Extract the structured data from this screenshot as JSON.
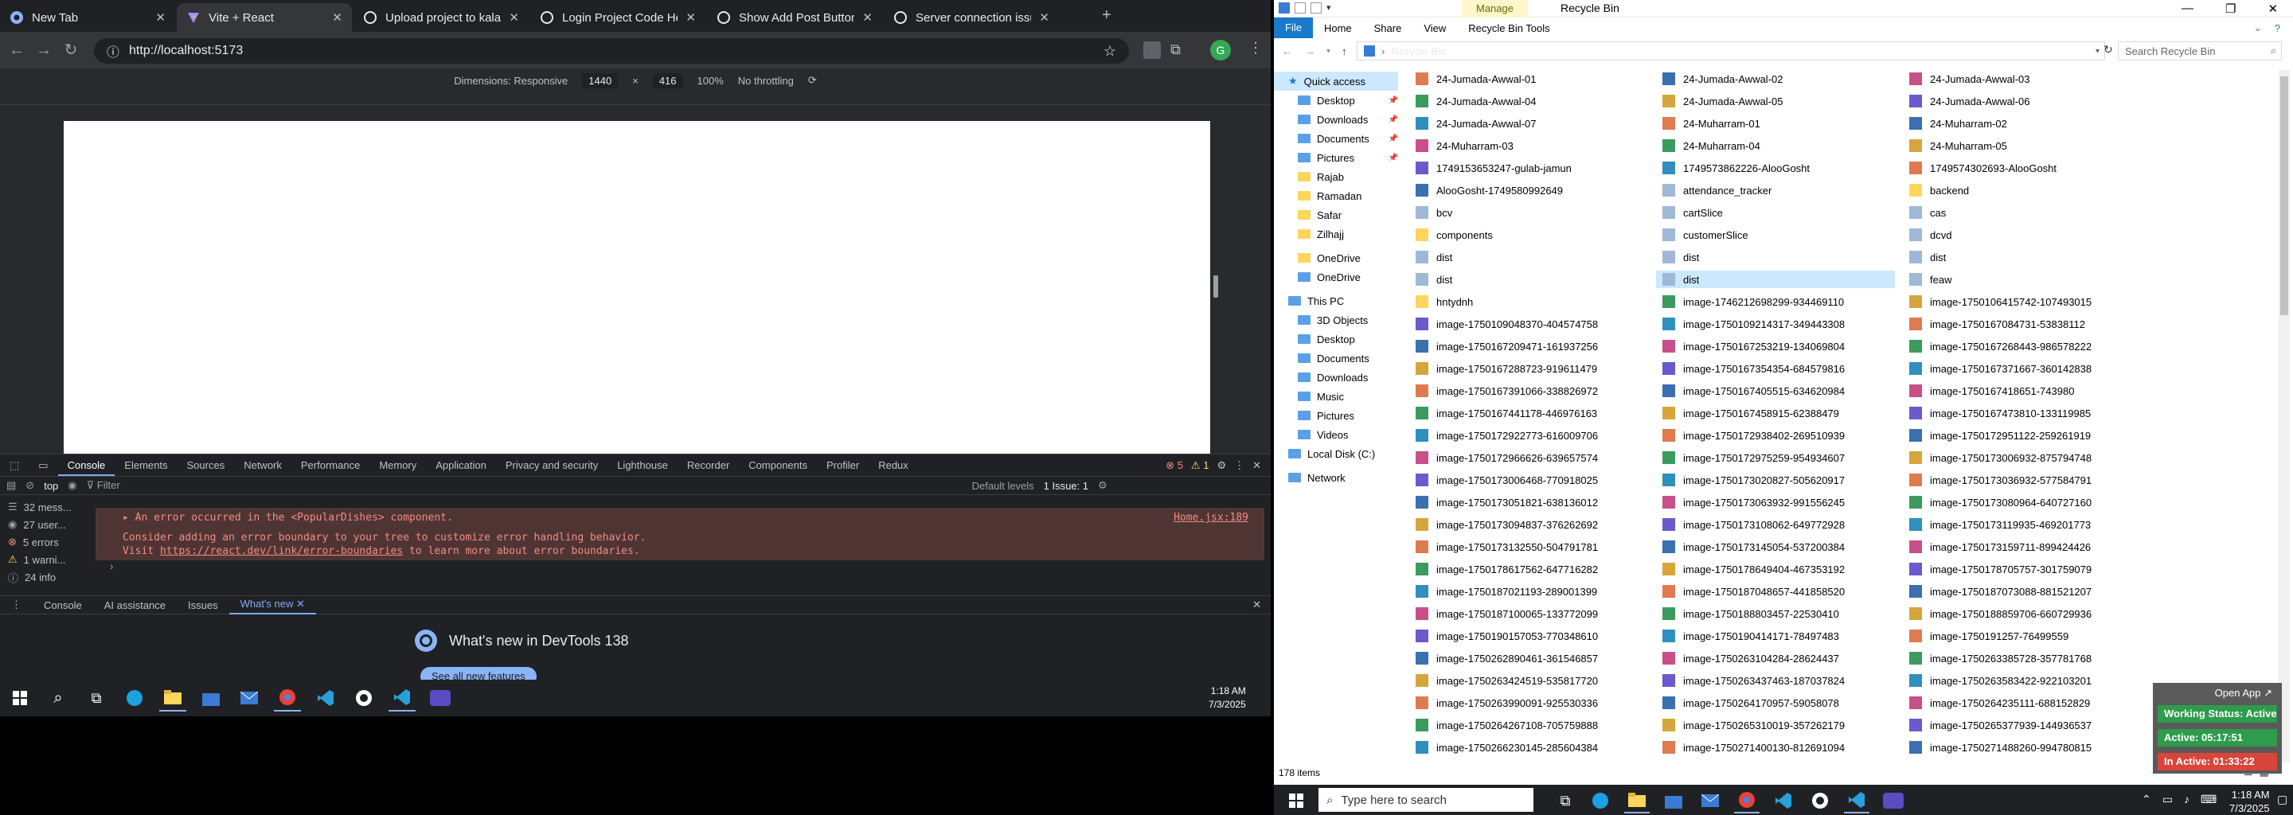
{
  "chrome": {
    "tabs": [
      {
        "title": "New Tab"
      },
      {
        "title": "Vite + React"
      },
      {
        "title": "Upload project to kalams.org"
      },
      {
        "title": "Login Project Code Help"
      },
      {
        "title": "Show Add Post Button"
      },
      {
        "title": "Server connection issue fix"
      }
    ],
    "url": "http://localhost:5173",
    "device_toolbar": {
      "dimensions_label": "Dimensions: Responsive",
      "width": "1440",
      "height": "416",
      "zoom": "100%",
      "throttle": "No throttling"
    },
    "devtools": {
      "tabs": [
        "Console",
        "Elements",
        "Sources",
        "Network",
        "Performance",
        "Memory",
        "Application",
        "Privacy and security",
        "Lighthouse",
        "Recorder",
        "Components",
        "Profiler",
        "Redux"
      ],
      "errors_badge": "5",
      "warn_badge": "1",
      "filter_context": "top",
      "filter_placeholder": "Filter",
      "levels": "Default levels",
      "issues": "1 Issue: 1",
      "sidebar": [
        "32 mess...",
        "27 user...",
        "5 errors",
        "1 warni...",
        "24 info"
      ],
      "error_line1": "An error occurred in the <PopularDishes> component.",
      "error_source": "Home.jsx:189",
      "error_line2": "Consider adding an error boundary to your tree to customize error handling behavior.",
      "error_line3_pre": "Visit ",
      "error_link": "https://react.dev/link/error-boundaries",
      "error_line3_post": " to learn more about error boundaries.",
      "drawer_tabs": [
        "Console",
        "AI assistance",
        "Issues",
        "What's new"
      ],
      "whats_new": "What's new in DevTools 138",
      "see_all": "See all new features"
    },
    "clock": {
      "time": "1:18 AM",
      "date": "7/3/2025"
    }
  },
  "explorer": {
    "manage": "Manage",
    "title": "Recycle Bin",
    "ribbon": [
      "File",
      "Home",
      "Share",
      "View",
      "Recycle Bin Tools"
    ],
    "address": "Recycle Bin",
    "search_placeholder": "Search Recycle Bin",
    "nav": [
      {
        "label": "Quick access",
        "type": "star"
      },
      {
        "label": "Desktop",
        "type": "blue",
        "pin": true
      },
      {
        "label": "Downloads",
        "type": "blue",
        "pin": true
      },
      {
        "label": "Documents",
        "type": "blue",
        "pin": true
      },
      {
        "label": "Pictures",
        "type": "blue",
        "pin": true
      },
      {
        "label": "Rajab",
        "type": "folder"
      },
      {
        "label": "Ramadan",
        "type": "folder"
      },
      {
        "label": "Safar",
        "type": "folder"
      },
      {
        "label": "Zilhajj",
        "type": "folder"
      },
      {
        "label": "OneDrive",
        "type": "folder"
      },
      {
        "label": "OneDrive",
        "type": "blue"
      },
      {
        "label": "This PC",
        "type": "pc"
      },
      {
        "label": "3D Objects",
        "type": "blue"
      },
      {
        "label": "Desktop",
        "type": "blue"
      },
      {
        "label": "Documents",
        "type": "blue"
      },
      {
        "label": "Downloads",
        "type": "blue"
      },
      {
        "label": "Music",
        "type": "blue"
      },
      {
        "label": "Pictures",
        "type": "blue"
      },
      {
        "label": "Videos",
        "type": "blue"
      },
      {
        "label": "Local Disk (C:)",
        "type": "pc"
      },
      {
        "label": "Network",
        "type": "pc"
      }
    ],
    "files": [
      [
        "24-Jumada-Awwal-01",
        "24-Jumada-Awwal-02",
        "24-Jumada-Awwal-03"
      ],
      [
        "24-Jumada-Awwal-04",
        "24-Jumada-Awwal-05",
        "24-Jumada-Awwal-06"
      ],
      [
        "24-Jumada-Awwal-07",
        "24-Muharram-01",
        "24-Muharram-02"
      ],
      [
        "24-Muharram-03",
        "24-Muharram-04",
        "24-Muharram-05"
      ],
      [
        "1749153653247-gulab-jamun",
        "1749573862226-AlooGosht",
        "1749574302693-AlooGosht"
      ],
      [
        "AlooGosht-1749580992649",
        "attendance_tracker",
        "backend"
      ],
      [
        "bcv",
        "cartSlice",
        "cas"
      ],
      [
        "components",
        "customerSlice",
        "dcvd"
      ],
      [
        "dist",
        "dist",
        "dist"
      ],
      [
        "dist",
        "dist",
        "feaw"
      ],
      [
        "hntydnh",
        "image-1746212698299-934469110",
        "image-1750106415742-107493015"
      ],
      [
        "image-1750109048370-404574758",
        "image-1750109214317-349443308",
        "image-1750167084731-53838112"
      ],
      [
        "image-1750167209471-161937256",
        "image-1750167253219-134069804",
        "image-1750167268443-986578222"
      ],
      [
        "image-1750167288723-919611479",
        "image-1750167354354-684579816",
        "image-1750167371667-360142838"
      ],
      [
        "image-1750167391066-338826972",
        "image-1750167405515-634620984",
        "image-1750167418651-743980"
      ],
      [
        "image-1750167441178-446976163",
        "image-1750167458915-62388479",
        "image-1750167473810-133119985"
      ],
      [
        "image-1750172922773-616009706",
        "image-1750172938402-269510939",
        "image-1750172951122-259261919"
      ],
      [
        "image-1750172966626-639657574",
        "image-1750172975259-954934607",
        "image-1750173006932-875794748"
      ],
      [
        "image-1750173006468-770918025",
        "image-1750173020827-505620917",
        "image-1750173036932-577584791"
      ],
      [
        "image-1750173051821-638136012",
        "image-1750173063932-991556245",
        "image-1750173080964-640727160"
      ],
      [
        "image-1750173094837-376262692",
        "image-1750173108062-649772928",
        "image-1750173119935-469201773"
      ],
      [
        "image-1750173132550-504791781",
        "image-1750173145054-537200384",
        "image-1750173159711-899424426"
      ],
      [
        "image-1750178617562-647716282",
        "image-1750178649404-467353192",
        "image-1750178705757-301759079"
      ],
      [
        "image-1750187021193-289001399",
        "image-1750187048657-441858520",
        "image-1750187073088-881521207"
      ],
      [
        "image-1750187100065-133772099",
        "image-1750188803457-22530410",
        "image-1750188859706-660729936"
      ],
      [
        "image-1750190157053-770348610",
        "image-1750190414171-78497483",
        "image-1750191257-76499559"
      ],
      [
        "image-1750262890461-361546857",
        "image-1750263104284-28624437",
        "image-1750263385728-357781768"
      ],
      [
        "image-1750263424519-535817720",
        "image-1750263437463-187037824",
        "image-1750263583422-922103201"
      ],
      [
        "image-1750263990091-925530336",
        "image-1750264170957-59058078",
        "image-1750264235111-688152829"
      ],
      [
        "image-1750264267108-705759888",
        "image-1750265310019-357262179",
        "image-1750265377939-144936537"
      ],
      [
        "image-1750266230145-285604384",
        "image-1750271400130-812691094",
        "image-1750271488260-994780815"
      ]
    ],
    "item_count": "178 items"
  },
  "widget": {
    "open_app": "Open App",
    "working": "Working Status: Active",
    "active": "Active: 05:17:51",
    "inactive": "In Active: 01:33:22"
  },
  "taskbar": {
    "search_placeholder": "Type here to search",
    "clock": {
      "time": "1:18 AM",
      "date": "7/3/2025"
    }
  },
  "colors": {
    "accent": "#1979ca",
    "chrome_bg": "#202124",
    "error_bg": "#4e3534",
    "widget_green": "#2e9b4d",
    "widget_red": "#d9453a"
  }
}
